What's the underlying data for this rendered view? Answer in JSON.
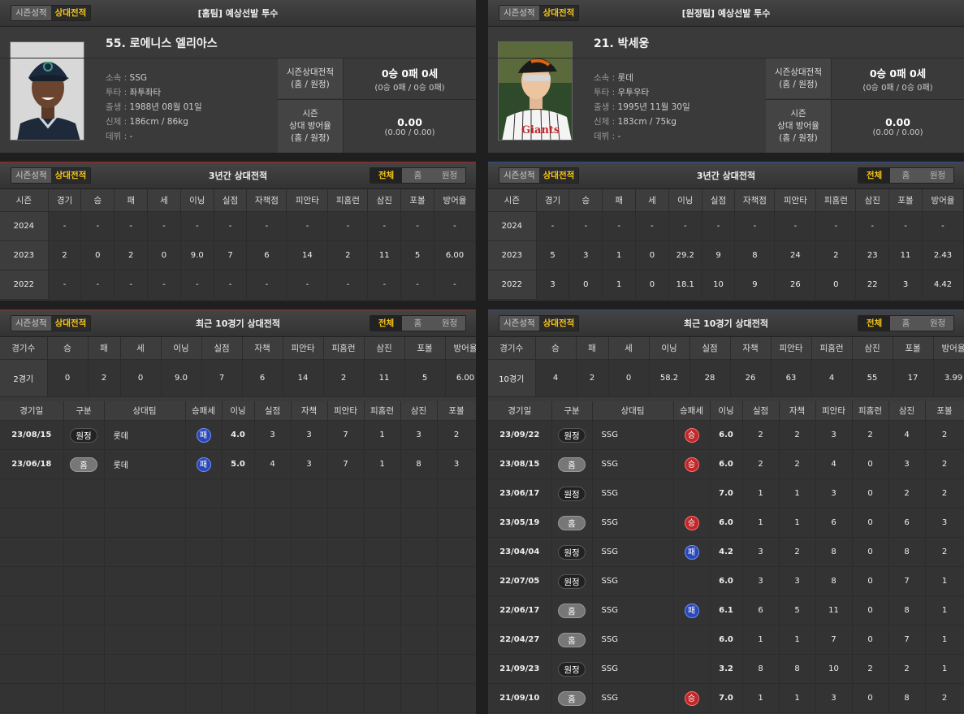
{
  "colors": {
    "accent": "#f5c518",
    "home_border": "#b02020",
    "away_border": "#2a4aa0",
    "win": "#c0282a",
    "loss": "#2a48b8"
  },
  "tabs": {
    "season": "시즌성적",
    "matchup": "상대전적"
  },
  "filters": [
    "전체",
    "홈",
    "원정"
  ],
  "home": {
    "panel_title": "[홈팀] 예상선발 투수",
    "name": "55. 로에니스 엘리아스",
    "team_label": "소속 : ",
    "team": "SSG",
    "throw_label": "투타 : ",
    "throw": "좌투좌타",
    "birth_label": "출생 : ",
    "birth": "1988년 08월 01일",
    "body_label": "신체 : ",
    "body": "186cm / 86kg",
    "debut_label": "데뷔 : ",
    "debut": "-",
    "rec_label1": "시즌상대전적",
    "rec_label2": "(홈 / 원정)",
    "rec_main": "0승 0패 0세",
    "rec_sub": "(0승 0패 / 0승 0패)",
    "era_label1": "시즌",
    "era_label2": "상대 방어율",
    "era_label3": "(홈 / 원정)",
    "era_main": "0.00",
    "era_sub": "(0.00 / 0.00)",
    "three_title": "3년간 상대전적",
    "recent_title": "최근 10경기 상대전적",
    "three_headers": [
      "시즌",
      "경기",
      "승",
      "패",
      "세",
      "이닝",
      "실점",
      "자책점",
      "피안타",
      "피홈런",
      "삼진",
      "포볼",
      "방어율"
    ],
    "three_rows": [
      [
        "2024",
        "-",
        "-",
        "-",
        "-",
        "-",
        "-",
        "-",
        "-",
        "-",
        "-",
        "-",
        "-"
      ],
      [
        "2023",
        "2",
        "0",
        "2",
        "0",
        "9.0",
        "7",
        "6",
        "14",
        "2",
        "11",
        "5",
        "6.00"
      ],
      [
        "2022",
        "-",
        "-",
        "-",
        "-",
        "-",
        "-",
        "-",
        "-",
        "-",
        "-",
        "-",
        "-"
      ]
    ],
    "sum_headers": [
      "경기수",
      "승",
      "패",
      "세",
      "이닝",
      "실점",
      "자책",
      "피안타",
      "피홈런",
      "삼진",
      "포볼",
      "방어율"
    ],
    "sum_row": [
      "2경기",
      "0",
      "2",
      "0",
      "9.0",
      "7",
      "6",
      "14",
      "2",
      "11",
      "5",
      "6.00"
    ],
    "game_headers": [
      "경기일",
      "구분",
      "상대팀",
      "승패세",
      "이닝",
      "실점",
      "자책",
      "피안타",
      "피홈런",
      "삼진",
      "포볼"
    ],
    "games": [
      {
        "date": "23/08/15",
        "type": "원정",
        "opp": "롯데",
        "res": "패",
        "ip": "4.0",
        "r": "3",
        "er": "3",
        "h": "7",
        "hr": "1",
        "so": "3",
        "bb": "2"
      },
      {
        "date": "23/06/18",
        "type": "홈",
        "opp": "롯데",
        "res": "패",
        "ip": "5.0",
        "r": "4",
        "er": "3",
        "h": "7",
        "hr": "1",
        "so": "8",
        "bb": "3"
      }
    ]
  },
  "away": {
    "panel_title": "[원정팀] 예상선발 투수",
    "name": "21. 박세웅",
    "team_label": "소속 : ",
    "team": "롯데",
    "throw_label": "투타 : ",
    "throw": "우투우타",
    "birth_label": "출생 : ",
    "birth": "1995년 11월 30일",
    "body_label": "신체 : ",
    "body": "183cm / 75kg",
    "debut_label": "데뷔 : ",
    "debut": "-",
    "rec_label1": "시즌상대전적",
    "rec_label2": "(홈 / 원정)",
    "rec_main": "0승 0패 0세",
    "rec_sub": "(0승 0패 / 0승 0패)",
    "era_label1": "시즌",
    "era_label2": "상대 방어율",
    "era_label3": "(홈 / 원정)",
    "era_main": "0.00",
    "era_sub": "(0.00 / 0.00)",
    "three_title": "3년간 상대전적",
    "recent_title": "최근 10경기 상대전적",
    "three_headers": [
      "시즌",
      "경기",
      "승",
      "패",
      "세",
      "이닝",
      "실점",
      "자책점",
      "피안타",
      "피홈런",
      "삼진",
      "포볼",
      "방어율"
    ],
    "three_rows": [
      [
        "2024",
        "-",
        "-",
        "-",
        "-",
        "-",
        "-",
        "-",
        "-",
        "-",
        "-",
        "-",
        "-"
      ],
      [
        "2023",
        "5",
        "3",
        "1",
        "0",
        "29.2",
        "9",
        "8",
        "24",
        "2",
        "23",
        "11",
        "2.43"
      ],
      [
        "2022",
        "3",
        "0",
        "1",
        "0",
        "18.1",
        "10",
        "9",
        "26",
        "0",
        "22",
        "3",
        "4.42"
      ]
    ],
    "sum_headers": [
      "경기수",
      "승",
      "패",
      "세",
      "이닝",
      "실점",
      "자책",
      "피안타",
      "피홈런",
      "삼진",
      "포볼",
      "방어율"
    ],
    "sum_row": [
      "10경기",
      "4",
      "2",
      "0",
      "58.2",
      "28",
      "26",
      "63",
      "4",
      "55",
      "17",
      "3.99"
    ],
    "game_headers": [
      "경기일",
      "구분",
      "상대팀",
      "승패세",
      "이닝",
      "실점",
      "자책",
      "피안타",
      "피홈런",
      "삼진",
      "포볼"
    ],
    "games": [
      {
        "date": "23/09/22",
        "type": "원정",
        "opp": "SSG",
        "res": "승",
        "ip": "6.0",
        "r": "2",
        "er": "2",
        "h": "3",
        "hr": "2",
        "so": "4",
        "bb": "2"
      },
      {
        "date": "23/08/15",
        "type": "홈",
        "opp": "SSG",
        "res": "승",
        "ip": "6.0",
        "r": "2",
        "er": "2",
        "h": "4",
        "hr": "0",
        "so": "3",
        "bb": "2"
      },
      {
        "date": "23/06/17",
        "type": "원정",
        "opp": "SSG",
        "res": "",
        "ip": "7.0",
        "r": "1",
        "er": "1",
        "h": "3",
        "hr": "0",
        "so": "2",
        "bb": "2"
      },
      {
        "date": "23/05/19",
        "type": "홈",
        "opp": "SSG",
        "res": "승",
        "ip": "6.0",
        "r": "1",
        "er": "1",
        "h": "6",
        "hr": "0",
        "so": "6",
        "bb": "3"
      },
      {
        "date": "23/04/04",
        "type": "원정",
        "opp": "SSG",
        "res": "패",
        "ip": "4.2",
        "r": "3",
        "er": "2",
        "h": "8",
        "hr": "0",
        "so": "8",
        "bb": "2"
      },
      {
        "date": "22/07/05",
        "type": "원정",
        "opp": "SSG",
        "res": "",
        "ip": "6.0",
        "r": "3",
        "er": "3",
        "h": "8",
        "hr": "0",
        "so": "7",
        "bb": "1"
      },
      {
        "date": "22/06/17",
        "type": "홈",
        "opp": "SSG",
        "res": "패",
        "ip": "6.1",
        "r": "6",
        "er": "5",
        "h": "11",
        "hr": "0",
        "so": "8",
        "bb": "1"
      },
      {
        "date": "22/04/27",
        "type": "홈",
        "opp": "SSG",
        "res": "",
        "ip": "6.0",
        "r": "1",
        "er": "1",
        "h": "7",
        "hr": "0",
        "so": "7",
        "bb": "1"
      },
      {
        "date": "21/09/23",
        "type": "원정",
        "opp": "SSG",
        "res": "",
        "ip": "3.2",
        "r": "8",
        "er": "8",
        "h": "10",
        "hr": "2",
        "so": "2",
        "bb": "1"
      },
      {
        "date": "21/09/10",
        "type": "홈",
        "opp": "SSG",
        "res": "승",
        "ip": "7.0",
        "r": "1",
        "er": "1",
        "h": "3",
        "hr": "0",
        "so": "8",
        "bb": "2"
      }
    ]
  }
}
